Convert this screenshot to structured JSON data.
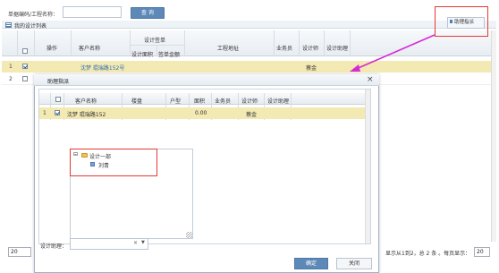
{
  "search": {
    "label": "单据编码/工程名称：",
    "value": "",
    "query_button": "查 询"
  },
  "panel": {
    "title": "我的设计列表"
  },
  "toolbar": {
    "assign_button": "助理指派"
  },
  "table": {
    "columns": {
      "action": "操作",
      "customer": "客户名称",
      "design_contract_group": "设计签单",
      "design_area": "设计面积",
      "contract_amount": "签单金额",
      "project_address": "工程地址",
      "salesperson": "业务员",
      "designer": "设计师",
      "design_assistant": "设计助理"
    },
    "rows": [
      {
        "num": "1",
        "customer": "沈梦 琨瑞路152号",
        "designer": "蔡金"
      },
      {
        "num": "2",
        "customer": "",
        "designer": ""
      }
    ]
  },
  "pager": {
    "page_size": "20",
    "info": "显示从1到2，总 2 条 。每页显示：",
    "page_size_right": "20"
  },
  "dialog": {
    "title": "助理指派",
    "close_glyph": "×",
    "columns": {
      "customer": "客户名称",
      "building": "楼盘",
      "room_type": "户型",
      "area": "面积",
      "salesperson": "业务员",
      "designer": "设计师",
      "design_assistant": "设计助理"
    },
    "rows": [
      {
        "num": "1",
        "customer": "沈梦 琨瑞路152",
        "building": "",
        "room_type": "",
        "area": "0.00",
        "salesperson": "",
        "designer": "蔡金",
        "design_assistant": ""
      }
    ],
    "tree": {
      "expander": "⊟",
      "group": "设计一部",
      "member": "刘青"
    },
    "helper_label": "设计助理：",
    "helper_clear": "×",
    "helper_dropdown": "▼",
    "confirm_button": "确定",
    "close_button": "关闭"
  },
  "colors": {
    "highlight_red": "#e53935",
    "arrow_magenta": "#d52bd5",
    "selected_row": "#f3e9b2",
    "primary_button": "#5d89b8"
  }
}
